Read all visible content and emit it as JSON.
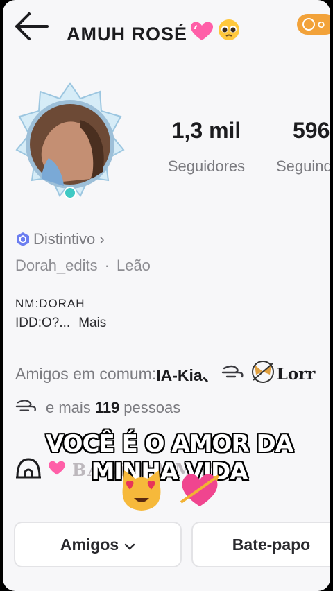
{
  "header": {
    "title": "AMUH ROSÉ",
    "coin_label": "O"
  },
  "stats": [
    {
      "value": "1,3 mil",
      "label": "Seguidores"
    },
    {
      "value": "596",
      "label": "Seguindo"
    }
  ],
  "profile": {
    "badge_label": "Distintivo ›",
    "username": "Dorah_edits",
    "sign": "Leão",
    "bio_line1": "NM:DORAH",
    "bio_line2": "IDD:O?...",
    "more_label": "Mais"
  },
  "common_friends": {
    "prefix": "Amigos em comum:",
    "names": "IA-Kia、",
    "third": "Lorr",
    "more_prefix": "e mais",
    "count": "119",
    "more_suffix": "pessoas"
  },
  "banner": {
    "text": "BABY DA MAY"
  },
  "caption": "VOCÊ É O AMOR DA MINHA VIDA",
  "buttons": {
    "friends": "Amigos",
    "chat": "Bate-papo"
  },
  "colors": {
    "background": "#f7f7f9",
    "text_primary": "#1c1c1f",
    "text_secondary": "#7b7b80",
    "accent_coin": "#f2a23a",
    "heart_pink": "#ff5fa8",
    "badge_blue": "#6c7ef0"
  }
}
